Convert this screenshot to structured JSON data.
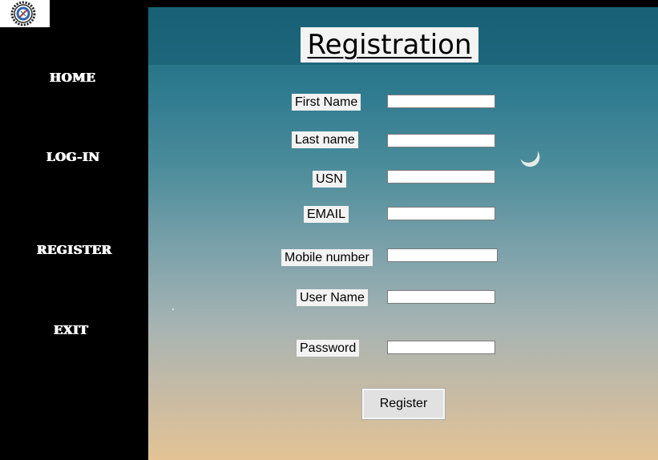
{
  "logo": {
    "icon": "gear-emblem-icon",
    "colors": {
      "ring": "#2a2a2a",
      "inner": "#2f64b0",
      "accent": "#c0392b"
    }
  },
  "sidebar": {
    "items": [
      {
        "label": "HOME"
      },
      {
        "label": "LOG-IN"
      },
      {
        "label": "REGISTER"
      },
      {
        "label": "EXIT"
      }
    ]
  },
  "form": {
    "title": "Registration",
    "fields": [
      {
        "label": "First Name",
        "value": ""
      },
      {
        "label": "Last name",
        "value": ""
      },
      {
        "label": "USN",
        "value": ""
      },
      {
        "label": "EMAIL",
        "value": ""
      },
      {
        "label": "Mobile number",
        "value": ""
      },
      {
        "label": "User Name",
        "value": ""
      },
      {
        "label": "Password",
        "value": ""
      }
    ],
    "submit_label": "Register"
  },
  "colors": {
    "sidebar_bg": "#000000",
    "nav_text": "#ffffff",
    "label_bg": "#f3f3f3",
    "button_bg": "#e1e1e1"
  }
}
